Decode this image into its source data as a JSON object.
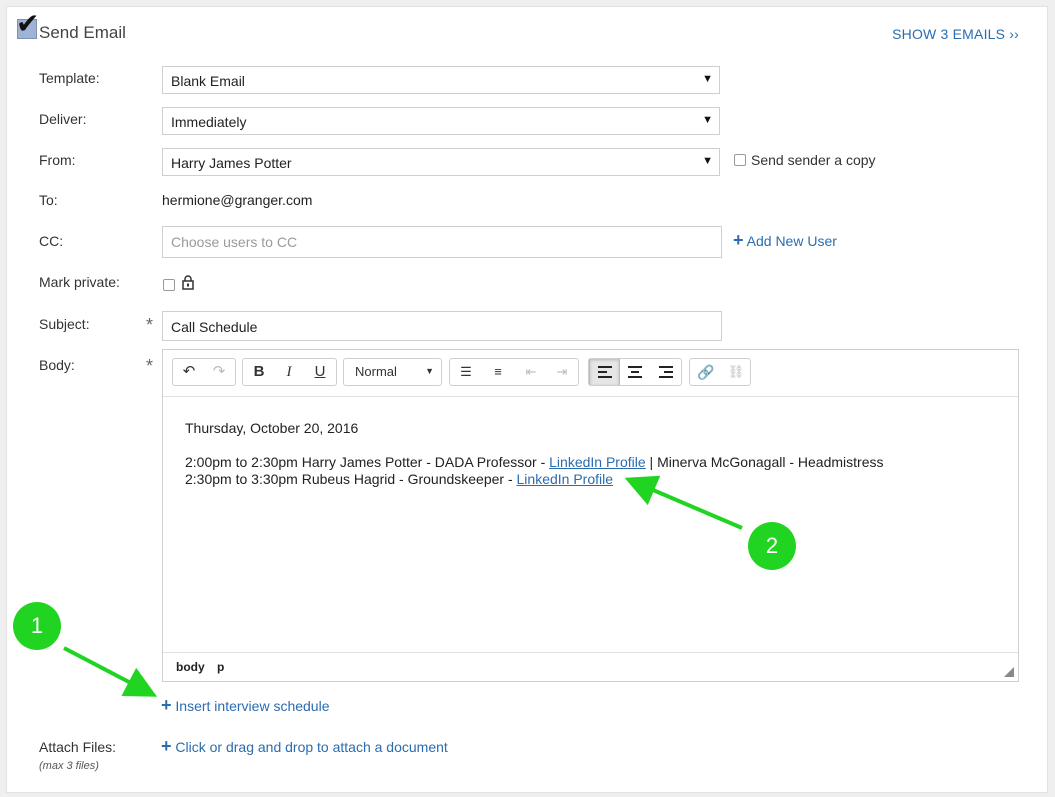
{
  "header": {
    "title": "Send Email",
    "show_emails": "SHOW 3 EMAILS ››"
  },
  "form": {
    "template_label": "Template:",
    "template_value": "Blank Email",
    "deliver_label": "Deliver:",
    "deliver_value": "Immediately",
    "from_label": "From:",
    "from_value": "Harry James Potter",
    "send_copy_label": "Send sender a copy",
    "to_label": "To:",
    "to_value": "hermione@granger.com",
    "cc_label": "CC:",
    "cc_placeholder": "Choose users to CC",
    "add_new_user": "Add New User",
    "private_label": "Mark private:",
    "subject_label": "Subject:",
    "subject_value": "Call Schedule",
    "body_label": "Body:",
    "required_mark": "*"
  },
  "toolbar": {
    "format_value": "Normal"
  },
  "editor": {
    "date_line": "Thursday, October 20, 2016",
    "line1_prefix": "2:00pm to 2:30pm Harry James Potter - DADA Professor - ",
    "line1_link": "LinkedIn Profile",
    "line1_suffix": " | Minerva McGonagall - Headmistress",
    "line2_prefix": "2:30pm to 3:30pm Rubeus Hagrid - Groundskeeper - ",
    "line2_link": "LinkedIn Profile",
    "status_body": "body",
    "status_p": "p"
  },
  "insert_schedule": "Insert interview schedule",
  "attach": {
    "label": "Attach Files:",
    "sub": "(max 3 files)",
    "link": "Click or drag and drop to attach a document"
  },
  "annotations": {
    "badge1": "1",
    "badge2": "2"
  },
  "colors": {
    "link": "#2a6cb0",
    "badge": "#22d422"
  }
}
